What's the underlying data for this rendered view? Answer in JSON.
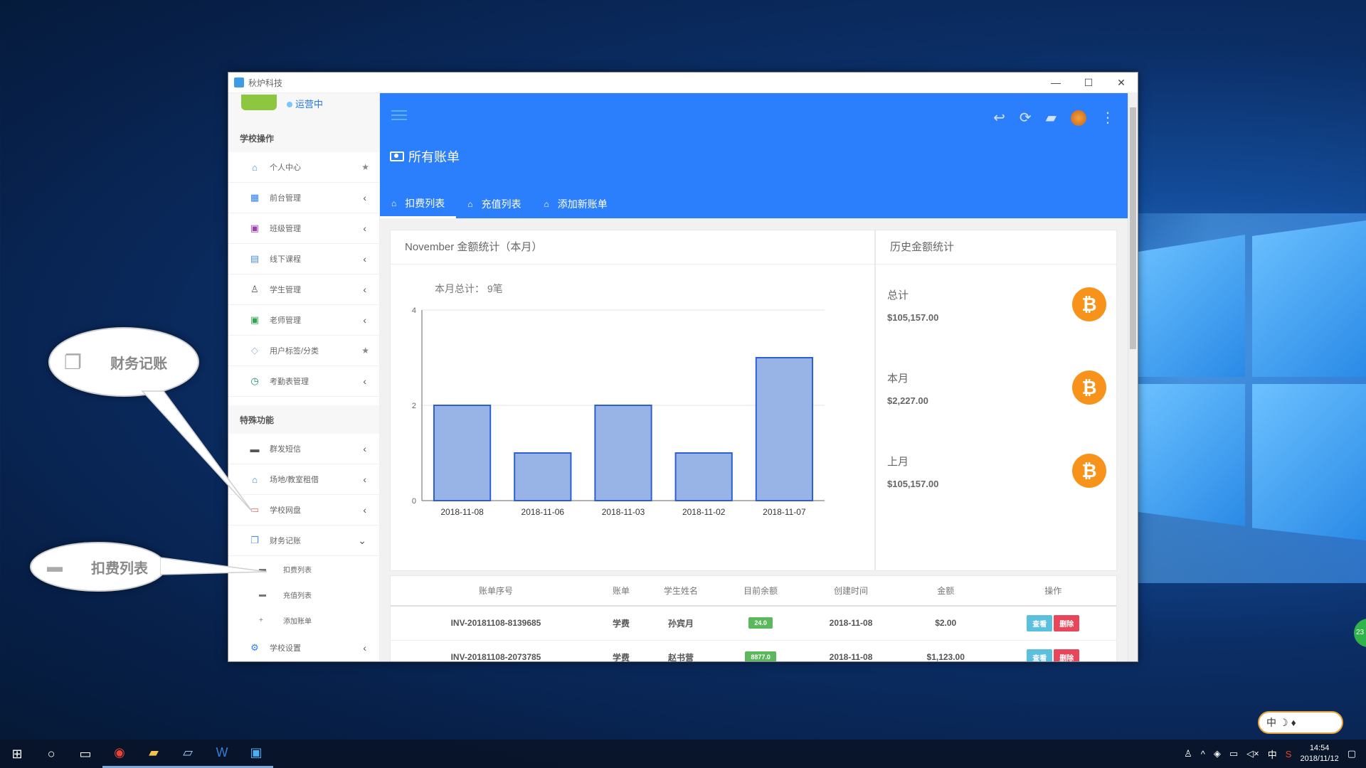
{
  "window": {
    "title": "秋炉科技",
    "controls": [
      "—",
      "☐",
      "✕"
    ]
  },
  "brand": {
    "status": "运营中"
  },
  "sidebar": {
    "section1": "学校操作",
    "items1": [
      {
        "label": "个人中心",
        "icon": "home-icon",
        "tail": "★"
      },
      {
        "label": "前台管理",
        "icon": "grid-icon",
        "tail": "‹"
      },
      {
        "label": "班级管理",
        "icon": "briefcase-icon",
        "tail": "‹"
      },
      {
        "label": "线下课程",
        "icon": "document-icon",
        "tail": "‹"
      },
      {
        "label": "学生管理",
        "icon": "person-icon",
        "tail": "‹"
      },
      {
        "label": "老师管理",
        "icon": "contact-icon",
        "tail": "‹"
      },
      {
        "label": "用户标签/分类",
        "icon": "tag-icon",
        "tail": "★"
      },
      {
        "label": "考勤表管理",
        "icon": "clock-icon",
        "tail": "‹"
      }
    ],
    "section2": "特殊功能",
    "items2": [
      {
        "label": "群发短信",
        "icon": "message-icon",
        "tail": "‹"
      },
      {
        "label": "场地/教室租借",
        "icon": "building-icon",
        "tail": "‹"
      },
      {
        "label": "学校网盘",
        "icon": "folder-icon",
        "tail": "‹"
      },
      {
        "label": "财务记账",
        "icon": "files-icon",
        "tail": "⌄"
      }
    ],
    "subitems": [
      {
        "label": "扣费列表",
        "icon": "card-icon"
      },
      {
        "label": "充值列表",
        "icon": "card-icon"
      },
      {
        "label": "添加账单",
        "icon": "plus-icon"
      }
    ],
    "settings": {
      "label": "学校设置",
      "icon": "gear-icon",
      "tail": "‹"
    }
  },
  "header": {
    "page_title": "所有账单",
    "tabs": [
      "扣费列表",
      "充值列表",
      "添加新账单"
    ]
  },
  "chart_card": {
    "title": "November 金额统计（本月）",
    "subtitle": "本月总计： 9笔"
  },
  "chart_data": {
    "type": "bar",
    "categories": [
      "2018-11-08",
      "2018-11-06",
      "2018-11-03",
      "2018-11-02",
      "2018-11-07"
    ],
    "values": [
      2,
      1,
      2,
      1,
      3
    ],
    "ylim": [
      0,
      4
    ],
    "yticks": [
      0,
      2,
      4
    ],
    "grid": true,
    "bar_color": "#98b3e6",
    "bar_stroke": "#2e5fd0"
  },
  "stats_card": {
    "title": "历史金额统计",
    "stats": [
      {
        "label": "总计",
        "amount": "$105,157.00"
      },
      {
        "label": "本月",
        "amount": "$2,227.00"
      },
      {
        "label": "上月",
        "amount": "$105,157.00"
      }
    ]
  },
  "table": {
    "headers": [
      "账单序号",
      "账单",
      "学生姓名",
      "目前余额",
      "创建时间",
      "金额",
      "操作"
    ],
    "rows": [
      {
        "id": "INV-20181108-8139685",
        "type": "学费",
        "name": "孙宾月",
        "balance": "24.0",
        "date": "2018-11-08",
        "amount": "$2.00"
      },
      {
        "id": "INV-20181108-2073785",
        "type": "学费",
        "name": "赵书营",
        "balance": "8877.0",
        "date": "2018-11-08",
        "amount": "$1,123.00"
      }
    ],
    "view_label": "查看",
    "delete_label": "删除"
  },
  "callouts": {
    "finance": "财务记账",
    "deduct": "扣费列表"
  },
  "taskbar": {
    "ime": "中",
    "time": "14:54",
    "date": "2018/11/12"
  },
  "ime_bar": {
    "label": "中"
  },
  "side_bubble": {
    "label": "23"
  }
}
